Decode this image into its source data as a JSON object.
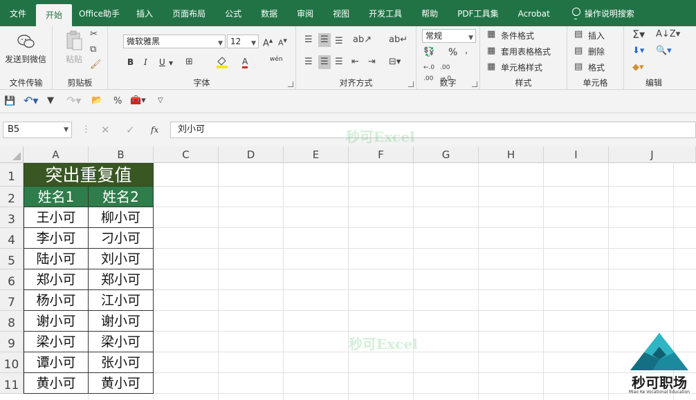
{
  "menu": {
    "items": [
      "文件",
      "开始",
      "Office助手",
      "插入",
      "页面布局",
      "公式",
      "数据",
      "审阅",
      "视图",
      "开发工具",
      "帮助",
      "PDF工具集",
      "Acrobat"
    ],
    "active_index": 1,
    "help_search": "操作说明搜索"
  },
  "ribbon": {
    "groups": {
      "file_transfer": {
        "label": "文件传输",
        "send_wechat": "发送到微信"
      },
      "clipboard": {
        "label": "剪贴板",
        "paste": "粘贴"
      },
      "font": {
        "label": "字体",
        "font_name": "微软雅黑",
        "font_size": "12",
        "bold": "B",
        "italic": "I",
        "underline": "U",
        "font_color": "A",
        "phonetic": "wén"
      },
      "alignment": {
        "label": "对齐方式"
      },
      "number": {
        "label": "数字",
        "format": "常规",
        "percent": "%"
      },
      "styles": {
        "label": "样式",
        "conditional": "条件格式",
        "table_format": "套用表格格式",
        "cell_style": "单元格样式"
      },
      "cells": {
        "label": "单元格",
        "insert": "插入",
        "delete": "删除",
        "format": "格式"
      },
      "editing": {
        "label": "编辑"
      }
    }
  },
  "formula_bar": {
    "name_box": "B5",
    "fx": "fx",
    "value": "刘小可"
  },
  "grid": {
    "columns": [
      "A",
      "B",
      "C",
      "D",
      "E",
      "F",
      "G",
      "H",
      "I",
      "J"
    ],
    "rows": [
      "1",
      "2",
      "3",
      "4",
      "5",
      "6",
      "7",
      "8",
      "9",
      "10",
      "11"
    ],
    "title": "突出重复值",
    "headers": [
      "姓名1",
      "姓名2"
    ],
    "col_a": [
      "王小可",
      "李小可",
      "陆小可",
      "郑小可",
      "杨小可",
      "谢小可",
      "梁小可",
      "谭小可",
      "黄小可"
    ],
    "col_b": [
      "柳小可",
      "刁小可",
      "刘小可",
      "郑小可",
      "江小可",
      "谢小可",
      "梁小可",
      "张小可",
      "黄小可"
    ]
  },
  "watermark": "秒可Excel",
  "logo": {
    "name": "秒可职场",
    "sub": "Miao Ke Vocational Education"
  },
  "colors": {
    "accent": "#217346",
    "title_fill": "#385723",
    "header_fill": "#2e7d4a"
  }
}
